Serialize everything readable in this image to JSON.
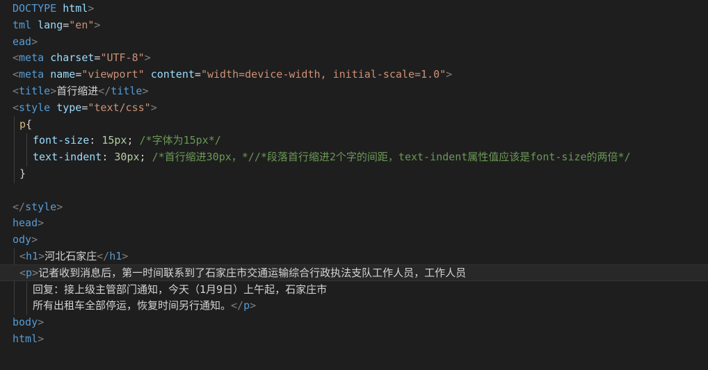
{
  "colors": {
    "background": "#1e1e1e",
    "tag": "#569cd6",
    "attr": "#9cdcfe",
    "string": "#ce9178",
    "number": "#b5cea8",
    "comment": "#6a9955",
    "text": "#d4d4d4",
    "bracket": "#808080",
    "keyword": "#569cd6",
    "selector": "#d7ba7d"
  },
  "code_lines": [
    {
      "indent": 18,
      "tokens": [
        {
          "t": "DOCTYPE ",
          "c": "tag"
        },
        {
          "t": "html",
          "c": "attr"
        },
        {
          "t": ">",
          "c": "bracket"
        }
      ]
    },
    {
      "indent": 18,
      "tokens": [
        {
          "t": "tml ",
          "c": "tag"
        },
        {
          "t": "lang",
          "c": "attr"
        },
        {
          "t": "=",
          "c": "text"
        },
        {
          "t": "\"en\"",
          "c": "string"
        },
        {
          "t": ">",
          "c": "bracket"
        }
      ]
    },
    {
      "indent": 18,
      "tokens": [
        {
          "t": "ead",
          "c": "tag"
        },
        {
          "t": ">",
          "c": "bracket"
        }
      ]
    },
    {
      "indent": 18,
      "tokens": [
        {
          "t": "<",
          "c": "bracket"
        },
        {
          "t": "meta ",
          "c": "tag"
        },
        {
          "t": "charset",
          "c": "attr"
        },
        {
          "t": "=",
          "c": "text"
        },
        {
          "t": "\"UTF-8\"",
          "c": "string"
        },
        {
          "t": ">",
          "c": "bracket"
        }
      ]
    },
    {
      "indent": 18,
      "tokens": [
        {
          "t": "<",
          "c": "bracket"
        },
        {
          "t": "meta ",
          "c": "tag"
        },
        {
          "t": "name",
          "c": "attr"
        },
        {
          "t": "=",
          "c": "text"
        },
        {
          "t": "\"viewport\" ",
          "c": "string"
        },
        {
          "t": "content",
          "c": "attr"
        },
        {
          "t": "=",
          "c": "text"
        },
        {
          "t": "\"width=device-width, initial-scale=1.0\"",
          "c": "string"
        },
        {
          "t": ">",
          "c": "bracket"
        }
      ]
    },
    {
      "indent": 18,
      "tokens": [
        {
          "t": "<",
          "c": "bracket"
        },
        {
          "t": "title",
          "c": "tag"
        },
        {
          "t": ">",
          "c": "bracket"
        },
        {
          "t": "首行缩进",
          "c": "text"
        },
        {
          "t": "</",
          "c": "bracket"
        },
        {
          "t": "title",
          "c": "tag"
        },
        {
          "t": ">",
          "c": "bracket"
        }
      ]
    },
    {
      "indent": 18,
      "tokens": [
        {
          "t": "<",
          "c": "bracket"
        },
        {
          "t": "style ",
          "c": "tag"
        },
        {
          "t": "type",
          "c": "attr"
        },
        {
          "t": "=",
          "c": "text"
        },
        {
          "t": "\"text/css\"",
          "c": "string"
        },
        {
          "t": ">",
          "c": "bracket"
        }
      ]
    },
    {
      "indent": 28,
      "tokens": [
        {
          "t": "p",
          "c": "selector"
        },
        {
          "t": "{",
          "c": "text"
        }
      ]
    },
    {
      "indent": 47,
      "tokens": [
        {
          "t": "font-size",
          "c": "attr"
        },
        {
          "t": ": ",
          "c": "text"
        },
        {
          "t": "15px",
          "c": "number"
        },
        {
          "t": "; ",
          "c": "text"
        },
        {
          "t": "/*字体为15px*/",
          "c": "comment"
        }
      ]
    },
    {
      "indent": 47,
      "tokens": [
        {
          "t": "text-indent",
          "c": "attr"
        },
        {
          "t": ": ",
          "c": "text"
        },
        {
          "t": "30px",
          "c": "number"
        },
        {
          "t": "; ",
          "c": "text"
        },
        {
          "t": "/*首行缩进30px，*//*段落首行缩进2个字的间距，text-indent属性值应该是font-size的两倍*/",
          "c": "comment"
        }
      ]
    },
    {
      "indent": 28,
      "tokens": [
        {
          "t": "}",
          "c": "text"
        }
      ]
    },
    {
      "indent": 18,
      "tokens": []
    },
    {
      "indent": 18,
      "tokens": [
        {
          "t": "</",
          "c": "bracket"
        },
        {
          "t": "style",
          "c": "tag"
        },
        {
          "t": ">",
          "c": "bracket"
        }
      ]
    },
    {
      "indent": 18,
      "tokens": [
        {
          "t": "head",
          "c": "tag"
        },
        {
          "t": ">",
          "c": "bracket"
        }
      ]
    },
    {
      "indent": 18,
      "tokens": [
        {
          "t": "ody",
          "c": "tag"
        },
        {
          "t": ">",
          "c": "bracket"
        }
      ]
    },
    {
      "indent": 28,
      "tokens": [
        {
          "t": "<",
          "c": "bracket"
        },
        {
          "t": "h1",
          "c": "tag"
        },
        {
          "t": ">",
          "c": "bracket"
        },
        {
          "t": "河北石家庄",
          "c": "text"
        },
        {
          "t": "</",
          "c": "bracket"
        },
        {
          "t": "h1",
          "c": "tag"
        },
        {
          "t": ">",
          "c": "bracket"
        }
      ]
    },
    {
      "indent": 28,
      "highlight": true,
      "tokens": [
        {
          "t": "<",
          "c": "bracket"
        },
        {
          "t": "p",
          "c": "tag"
        },
        {
          "t": ">",
          "c": "bracket"
        },
        {
          "t": "记者收到消息后，第一时间联系到了石家庄市交通运输综合行政执法支队工作人员，工作人员",
          "c": "text"
        }
      ]
    },
    {
      "indent": 47,
      "tokens": [
        {
          "t": "回复：接上级主管部门通知，今天（1月9日）上午起，石家庄市",
          "c": "text"
        }
      ]
    },
    {
      "indent": 47,
      "tokens": [
        {
          "t": "所有出租车全部停运，恢复时间另行通知。",
          "c": "text"
        },
        {
          "t": "</",
          "c": "bracket"
        },
        {
          "t": "p",
          "c": "tag"
        },
        {
          "t": ">",
          "c": "bracket"
        }
      ]
    },
    {
      "indent": 18,
      "tokens": [
        {
          "t": "body",
          "c": "tag"
        },
        {
          "t": ">",
          "c": "bracket"
        }
      ]
    },
    {
      "indent": 18,
      "tokens": [
        {
          "t": "html",
          "c": "tag"
        },
        {
          "t": ">",
          "c": "bracket"
        }
      ]
    }
  ]
}
